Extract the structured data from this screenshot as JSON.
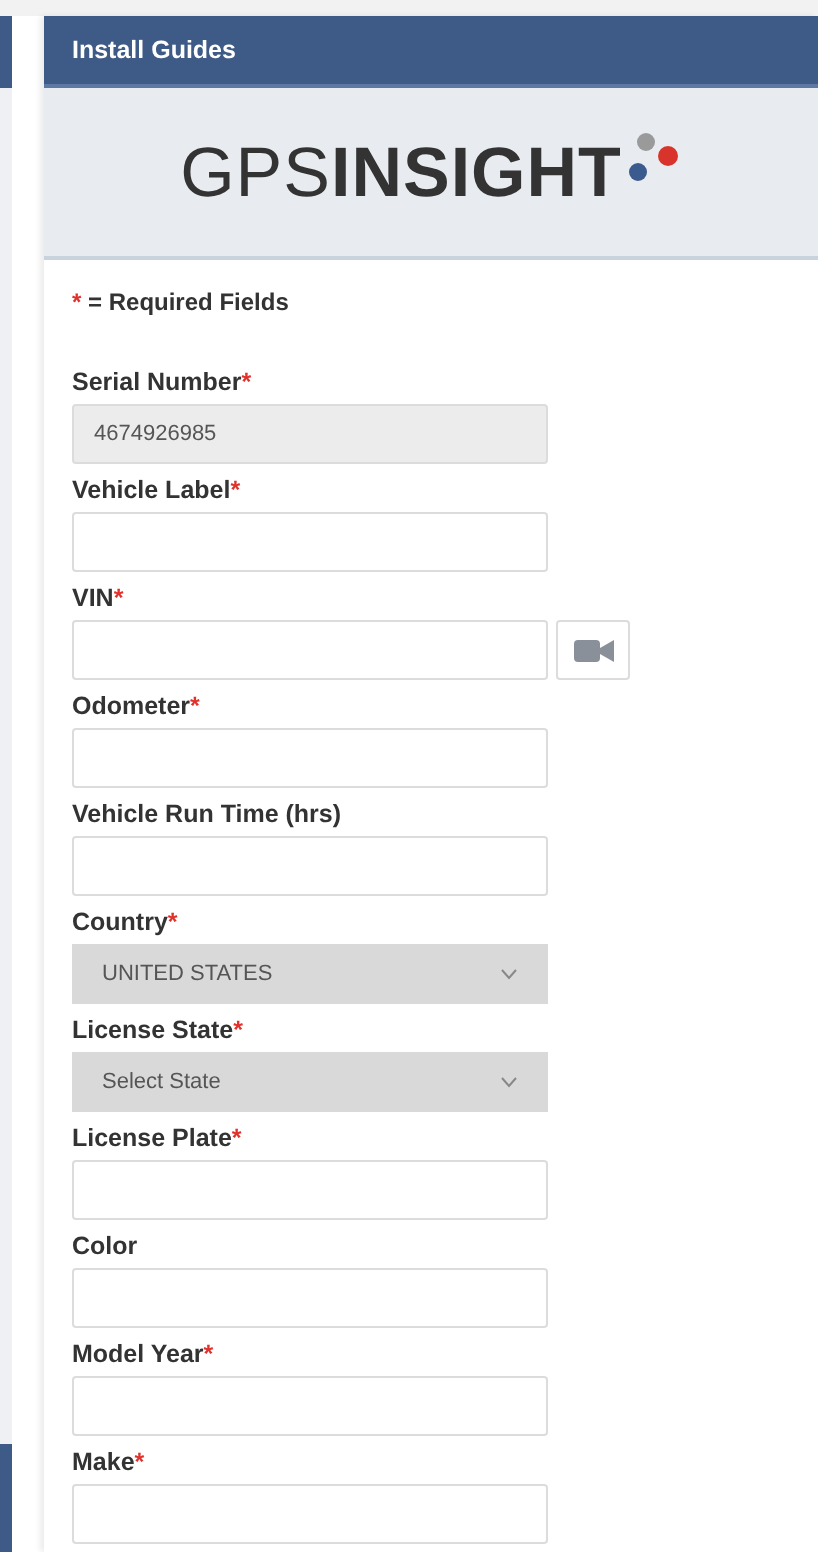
{
  "header": {
    "title": "Install Guides"
  },
  "logo": {
    "text": "GPS**INSIGHT**"
  },
  "legend": {
    "mark": "*",
    "text": "= Required Fields"
  },
  "fields": [
    {
      "kind": "text",
      "label": "Serial Number",
      "required_mark": "*",
      "value": "4674926985",
      "readonly": true
    },
    {
      "kind": "text",
      "label": "Vehicle Label",
      "required_mark": "*",
      "readonly": false
    },
    {
      "kind": "text_camera",
      "label": "VIN",
      "required_mark": "*",
      "readonly": false
    },
    {
      "kind": "text",
      "label": "Odometer",
      "required_mark": "*",
      "readonly": false
    },
    {
      "kind": "text",
      "label": "Vehicle Run Time (hrs)",
      "readonly": false
    },
    {
      "kind": "select",
      "label": "Country",
      "required_mark": "*",
      "value": "UNITED STATES"
    },
    {
      "kind": "select",
      "label": "License State",
      "required_mark": "*",
      "value": "Select State"
    },
    {
      "kind": "text",
      "label": "License Plate",
      "required_mark": "*",
      "readonly": false
    },
    {
      "kind": "text",
      "label": "Color",
      "readonly": false
    },
    {
      "kind": "text",
      "label": "Model Year",
      "required_mark": "*",
      "readonly": false
    },
    {
      "kind": "text",
      "label": "Make",
      "required_mark": "*",
      "readonly": false
    }
  ]
}
